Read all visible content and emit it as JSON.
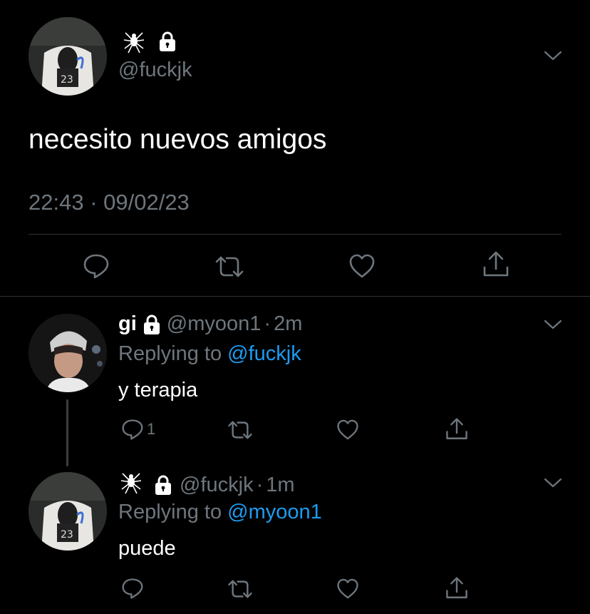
{
  "main_tweet": {
    "display_name_icon": "spider-emoji",
    "lock_icon": "lock-icon",
    "handle": "@fuckjk",
    "text": "necesito nuevos amigos",
    "timestamp": "22:43 · 09/02/23",
    "actions": [
      "reply-icon",
      "retweet-icon",
      "like-icon",
      "share-icon"
    ]
  },
  "replies": [
    {
      "display_name": "gi",
      "lock_icon": "lock-icon",
      "handle": "@myoon1",
      "separator": "·",
      "time": "2m",
      "replying_prefix": "Replying to",
      "replying_to": "@fuckjk",
      "text": "y terapia",
      "reply_count": "1"
    },
    {
      "display_name_icon": "spider-emoji",
      "lock_icon": "lock-icon",
      "handle": "@fuckjk",
      "separator": "·",
      "time": "1m",
      "replying_prefix": "Replying to",
      "replying_to": "@myoon1",
      "text": "puede"
    }
  ],
  "colors": {
    "background": "#000000",
    "text": "#ffffff",
    "muted": "#6e767d",
    "link": "#1d9bf0",
    "divider": "#2f3336"
  }
}
